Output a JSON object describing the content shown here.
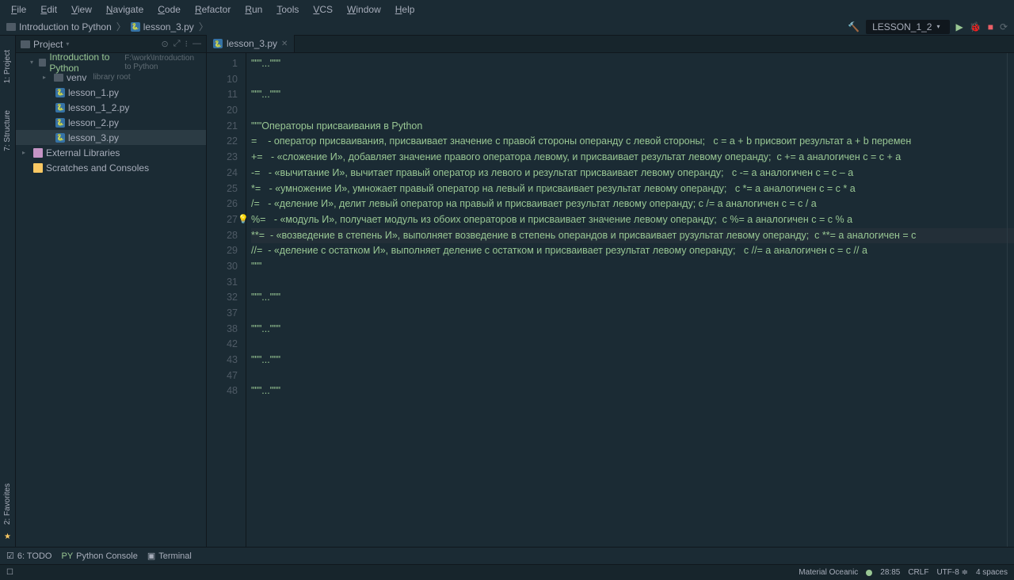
{
  "menu": [
    "File",
    "Edit",
    "View",
    "Navigate",
    "Code",
    "Refactor",
    "Run",
    "Tools",
    "VCS",
    "Window",
    "Help"
  ],
  "breadcrumb": {
    "project": "Introduction to Python",
    "file": "lesson_3.py"
  },
  "run_config": {
    "name": "LESSON_1_2"
  },
  "sidebar": {
    "title": "Project",
    "project_name": "Introduction to Python",
    "project_path": "F:\\work\\Introduction to Python",
    "venv": "venv",
    "venv_hint": "library root",
    "files": [
      "lesson_1.py",
      "lesson_1_2.py",
      "lesson_2.py",
      "lesson_3.py"
    ],
    "ext_lib": "External Libraries",
    "scratches": "Scratches and Consoles"
  },
  "left_tabs": {
    "project": "1: Project",
    "structure": "7: Structure",
    "favorites": "2: Favorites"
  },
  "tabs": [
    {
      "name": "lesson_3.py"
    }
  ],
  "gutter_start": 1,
  "code_lines": [
    {
      "n": 1,
      "t": "\"\"\"...\"\"\"",
      "cls": "s-str"
    },
    {
      "n": 10,
      "t": "",
      "cls": ""
    },
    {
      "n": 11,
      "t": "\"\"\"...\"\"\"",
      "cls": "s-str"
    },
    {
      "n": 20,
      "t": "",
      "cls": ""
    },
    {
      "n": 21,
      "t": "\"\"\"Операторы присваивания в Python",
      "cls": "s-str"
    },
    {
      "n": 22,
      "t": "=    - оператор присваивания, присваивает значение с правой стороны операнду с левой стороны;   c = a + b присвоит результат a + b перемен",
      "cls": "s-str"
    },
    {
      "n": 23,
      "t": "+=   - «сложение И», добавляет значение правого оператора левому, и присваивает результат левому операнду;  c += a аналогичен c = c + a",
      "cls": "s-str"
    },
    {
      "n": 24,
      "t": "-=   - «вычитание И», вычитает правый оператор из левого и результат присваивает левому операнду;   c -= a аналогичен c = c – a",
      "cls": "s-str"
    },
    {
      "n": 25,
      "t": "*=   - «умножение И», умножает правый оператор на левый и присваивает результат левому операнду;   c *= a аналогичен c = c * a",
      "cls": "s-str"
    },
    {
      "n": 26,
      "t": "/=   - «деление И», делит левый оператор на правый и присваивает результат левому операнду; c /= a аналогичен c = c / a",
      "cls": "s-str"
    },
    {
      "n": 27,
      "t": "%=   - «модуль И», получает модуль из обоих операторов и присваивает значение левому операнду;  c %= a аналогичен c = c % a",
      "cls": "s-str",
      "bulb": true
    },
    {
      "n": 28,
      "t": "**=  - «возведение в степень И», выполняет возведение в степень операндов и присваивает рузультат левому операнду;  c **= a аналогичен = c",
      "cls": "s-str",
      "current": true
    },
    {
      "n": 29,
      "t": "//=  - «деление с остатком И», выполняет деление с остатком и присваивает результат левому операнду;   c //= a аналогичен c = c // a",
      "cls": "s-str"
    },
    {
      "n": 30,
      "t": "\"\"\"",
      "cls": "s-str"
    },
    {
      "n": 31,
      "t": "",
      "cls": ""
    },
    {
      "n": 32,
      "t": "\"\"\"...\"\"\"",
      "cls": "s-str"
    },
    {
      "n": 37,
      "t": "",
      "cls": ""
    },
    {
      "n": 38,
      "t": "\"\"\"...\"\"\"",
      "cls": "s-str"
    },
    {
      "n": 42,
      "t": "",
      "cls": ""
    },
    {
      "n": 43,
      "t": "\"\"\"...\"\"\"",
      "cls": "s-str"
    },
    {
      "n": 47,
      "t": "",
      "cls": ""
    },
    {
      "n": 48,
      "t": "\"\"\"...\"\"\"",
      "cls": "s-str"
    }
  ],
  "bottom": {
    "todo": "6: TODO",
    "console": "Python Console",
    "terminal": "Terminal"
  },
  "status": {
    "theme": "Material Oceanic",
    "pos": "28:85",
    "eol": "CRLF",
    "enc": "UTF-8",
    "indent": "4 spaces"
  }
}
